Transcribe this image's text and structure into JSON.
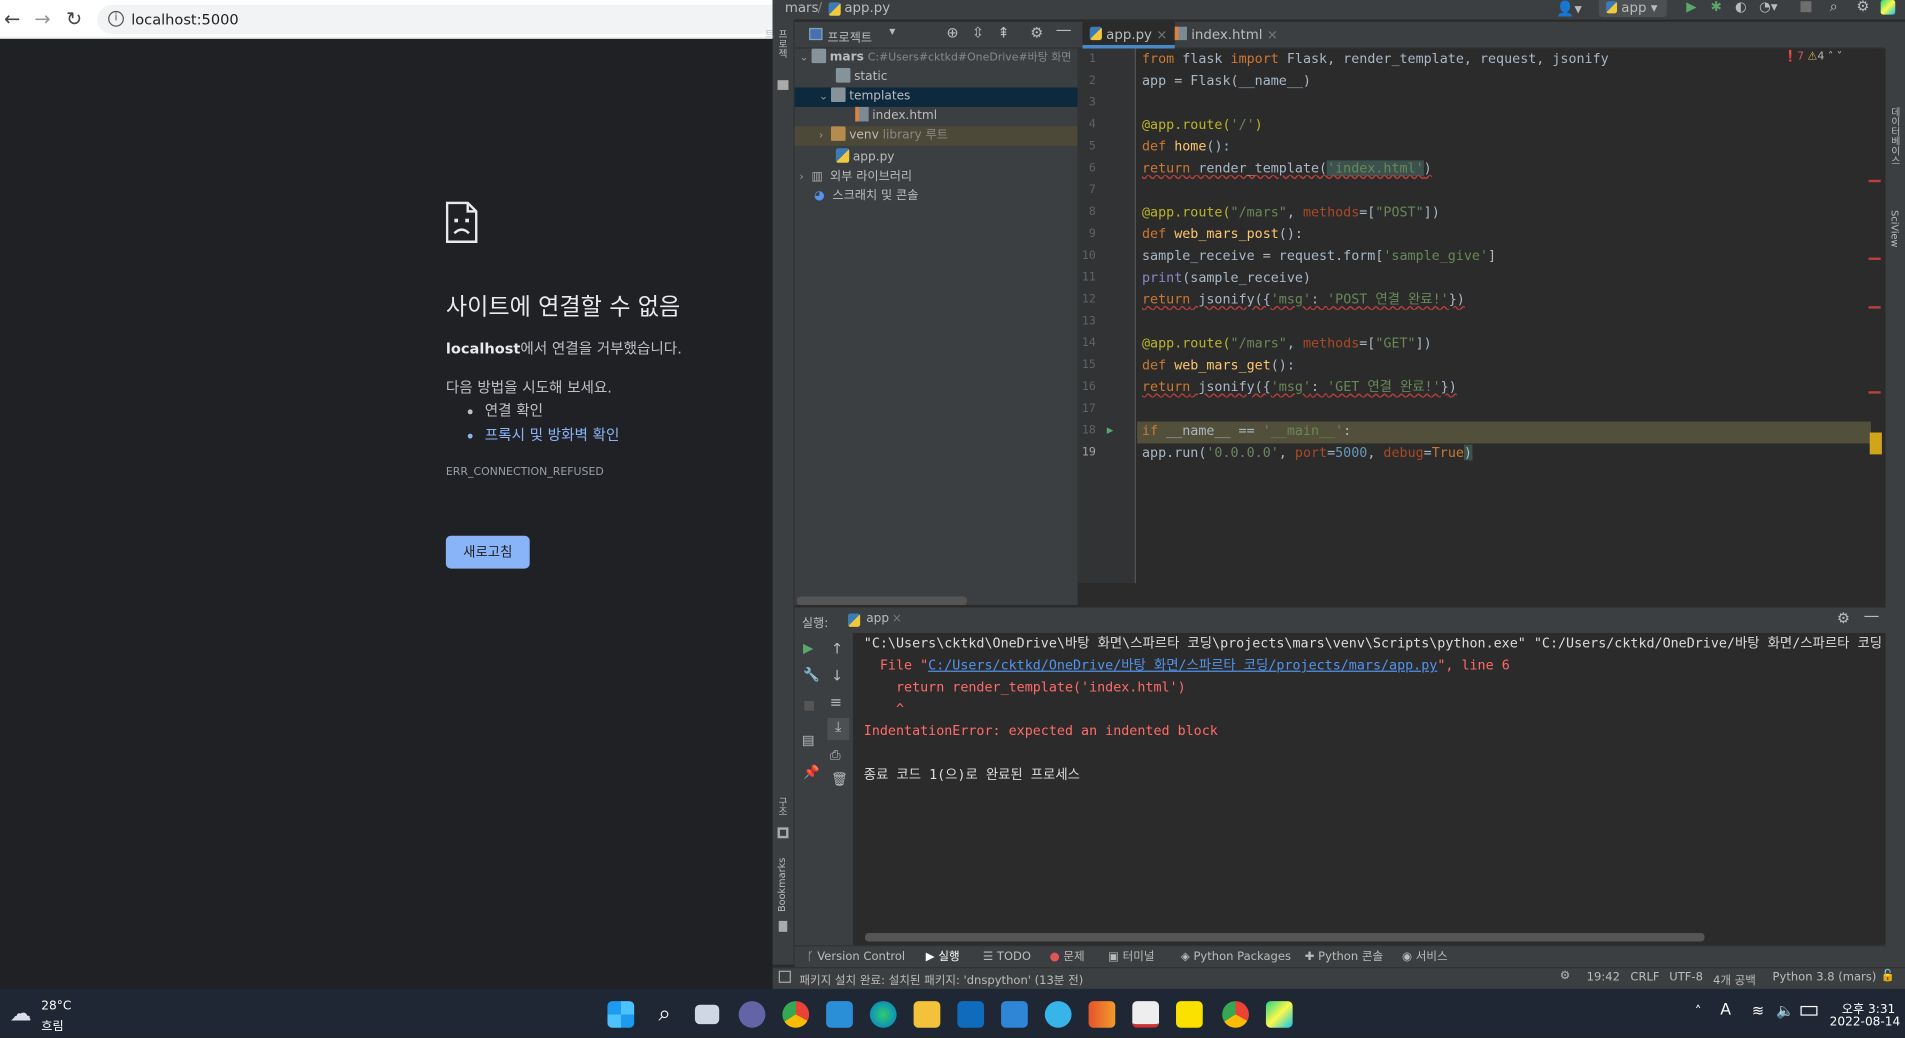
{
  "browser": {
    "url": "localhost:5000",
    "error_title": "사이트에 연결할 수 없음",
    "error_host": "localhost",
    "error_host_suffix": "에서 연결을 거부했습니다.",
    "try_text": "다음 방법을 시도해 보세요.",
    "suggestions": [
      "연결 확인",
      "프록시 및 방화벽 확인"
    ],
    "error_code": "ERR_CONNECTION_REFUSED",
    "reload_label": "새로고침"
  },
  "ide": {
    "breadcrumb_project": "mars",
    "breadcrumb_file": "app.py",
    "run_config": "app",
    "project_panel_label": "프로젝트",
    "tree": {
      "root_name": "mars",
      "root_path": "C:#Users#cktkd#OneDrive#바탕 화면",
      "static": "static",
      "templates": "templates",
      "index_html": "index.html",
      "venv": "venv",
      "venv_note": "library 루트",
      "app_py": "app.py",
      "external_libs": "외부 라이브러리",
      "scratches": "스크래치 및 콘솔"
    },
    "tabs": [
      "app.py",
      "index.html"
    ],
    "inspections": {
      "errors": "7",
      "warnings": "4"
    },
    "line_numbers": [
      "1",
      "2",
      "3",
      "4",
      "5",
      "6",
      "7",
      "8",
      "9",
      "10",
      "11",
      "12",
      "13",
      "14",
      "15",
      "16",
      "17",
      "18",
      "19"
    ],
    "code": {
      "l1": [
        "from",
        " flask ",
        "import",
        " Flask, render_template, request, jsonify"
      ],
      "l2": "app = Flask(__name__)",
      "l4": [
        "@app.route(",
        "'/'",
        ")"
      ],
      "l5": [
        "def",
        " ",
        "home",
        "():"
      ],
      "l6": [
        "return",
        " render_template(",
        "'index.html'",
        ")"
      ],
      "l8": [
        "@app.route(",
        "\"/mars\"",
        ", ",
        "methods",
        "=[",
        "\"POST\"",
        "])"
      ],
      "l9": [
        "def",
        " ",
        "web_mars_post",
        "():"
      ],
      "l10": [
        "sample_receive = request.form[",
        "'sample_give'",
        "]"
      ],
      "l11": [
        "print",
        "(sample_receive)"
      ],
      "l12": [
        "return",
        " jsonify({",
        "'msg'",
        ": ",
        "'POST 연결 완료!'",
        "})"
      ],
      "l14": [
        "@app.route(",
        "\"/mars\"",
        ", ",
        "methods",
        "=[",
        "\"GET\"",
        "])"
      ],
      "l15": [
        "def",
        " ",
        "web_mars_get",
        "():"
      ],
      "l16": [
        "return",
        " jsonify({",
        "'msg'",
        ": ",
        "'GET 연결 완료!'",
        "})"
      ],
      "l18": [
        "if",
        " __name__ == ",
        "'__main__'",
        ":"
      ],
      "l19": [
        "app.run(",
        "'0.0.0.0'",
        ", ",
        "port",
        "=",
        "5000",
        ", ",
        "debug",
        "=",
        "True",
        ")"
      ]
    },
    "run": {
      "label": "실행:",
      "tab": "app",
      "lines": [
        "\"C:\\Users\\cktkd\\OneDrive\\바탕 화면\\스파르타 코딩\\projects\\mars\\venv\\Scripts\\python.exe\" \"C:/Users/cktkd/OneDrive/바탕 화면/스파르타 코딩",
        "  File \"",
        "C:/Users/cktkd/OneDrive/바탕 화면/스파르타 코딩/projects/mars/app.py",
        "\", line 6",
        "    return render_template('index.html')",
        "    ^",
        "IndentationError: expected an indented block",
        "종료 코드 1(으)로 완료된 프로세스"
      ]
    },
    "bottom_tabs": [
      "Version Control",
      "실행",
      "TODO",
      "문제",
      "터미널",
      "Python Packages",
      "Python 콘솔",
      "서비스"
    ],
    "status": {
      "message": "패키지 설치 완료: 설치된 패키지: 'dnspython' (13분 전)",
      "position": "19:42",
      "line_ending": "CRLF",
      "encoding": "UTF-8",
      "indent": "4개 공백",
      "interpreter": "Python 3.8 (mars)"
    },
    "side_labels": {
      "bookmarks": "Bookmarks",
      "structure": "구조",
      "sciview": "SciView",
      "database": "데이터베이스"
    }
  },
  "taskbar": {
    "weather_temp": "28°C",
    "weather_desc": "흐림",
    "ime": "A",
    "time": "오후 3:31",
    "date": "2022-08-14"
  },
  "colors": {
    "accent": "#8ab4f8",
    "ide_bg": "#2b2b2b",
    "error": "#ff6b68",
    "keyword": "#cc7832",
    "string": "#6a8759"
  }
}
